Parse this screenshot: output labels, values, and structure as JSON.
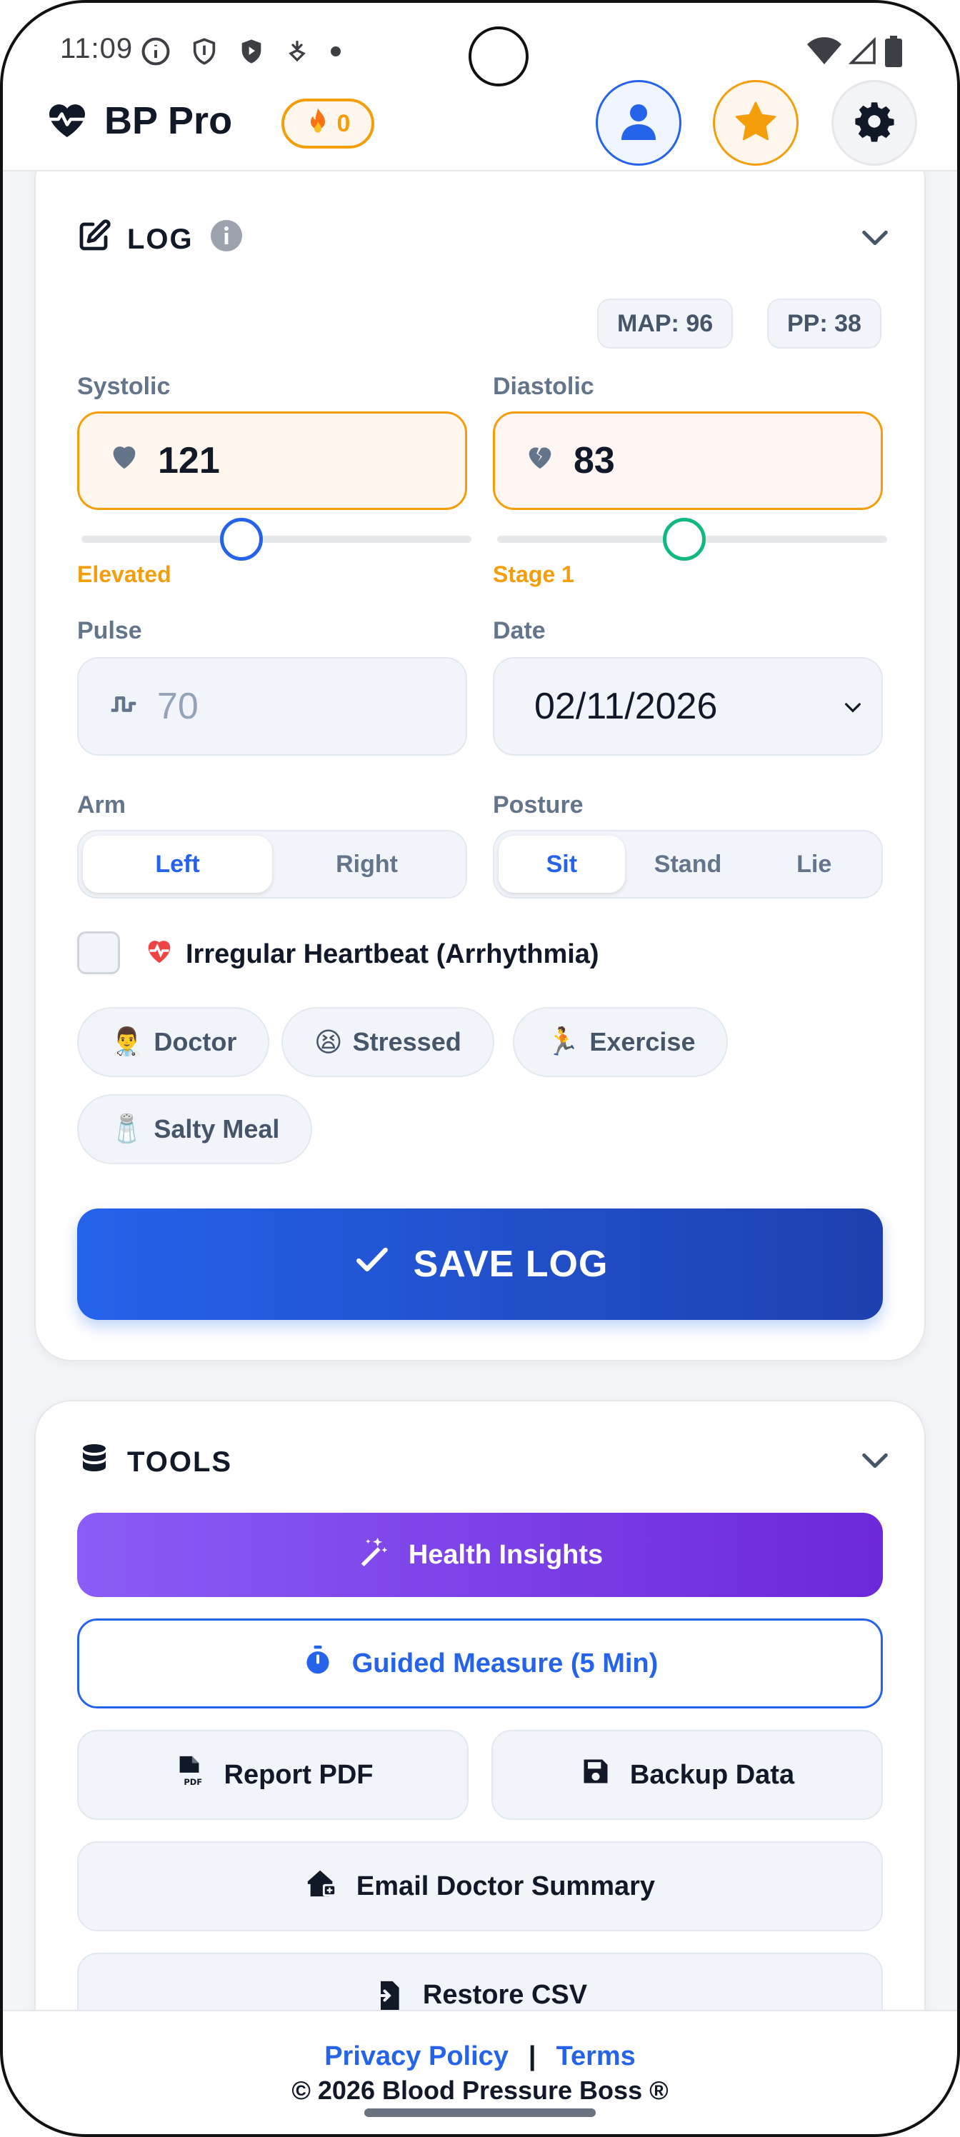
{
  "status_bar": {
    "time": "11:09",
    "icons": [
      "info-icon",
      "shield-icon",
      "play-protect-icon",
      "download-icon",
      "dot-icon"
    ],
    "right_icons": [
      "wifi-icon",
      "signal-icon",
      "battery-icon"
    ]
  },
  "header": {
    "app_name": "BP Pro",
    "streak_count": "0",
    "streak_icon": "fire-icon"
  },
  "log": {
    "title": "LOG",
    "map": "MAP: 96",
    "pp": "PP: 38",
    "systolic_label": "Systolic",
    "systolic_value": "121",
    "systolic_category": "Elevated",
    "systolic_slider_level": 0.41,
    "diastolic_label": "Diastolic",
    "diastolic_value": "83",
    "diastolic_category": "Stage 1",
    "diastolic_slider_level": 0.48,
    "pulse_label": "Pulse",
    "pulse_placeholder": "70",
    "date_label": "Date",
    "date_value": "02/11/2026",
    "arm_label": "Arm",
    "arm_options": [
      "Left",
      "Right"
    ],
    "arm_selected": "Left",
    "posture_label": "Posture",
    "posture_options": [
      "Sit",
      "Stand",
      "Lie"
    ],
    "posture_selected": "Sit",
    "irregular_label": "Irregular Heartbeat (Arrhythmia)",
    "irregular_checked": false,
    "tags": [
      {
        "emoji": "👨‍⚕️",
        "label": "Doctor"
      },
      {
        "emoji": "😫",
        "label": "Stressed"
      },
      {
        "emoji": "🏃",
        "label": "Exercise"
      },
      {
        "emoji": "🧂",
        "label": "Salty Meal"
      }
    ],
    "save_label": "SAVE LOG"
  },
  "tools": {
    "title": "TOOLS",
    "insights": "Health Insights",
    "guided": "Guided Measure (5 Min)",
    "report_pdf": "Report PDF",
    "backup": "Backup Data",
    "email_doctor": "Email Doctor Summary",
    "restore_csv": "Restore CSV"
  },
  "footer": {
    "privacy": "Privacy Policy",
    "separator": "|",
    "terms": "Terms",
    "copyright": "© 2026 Blood Pressure Boss ®"
  },
  "colors": {
    "primary": "#2563eb",
    "warning": "#f59e0b",
    "purple": "#7c3aed",
    "success": "#10b981"
  }
}
